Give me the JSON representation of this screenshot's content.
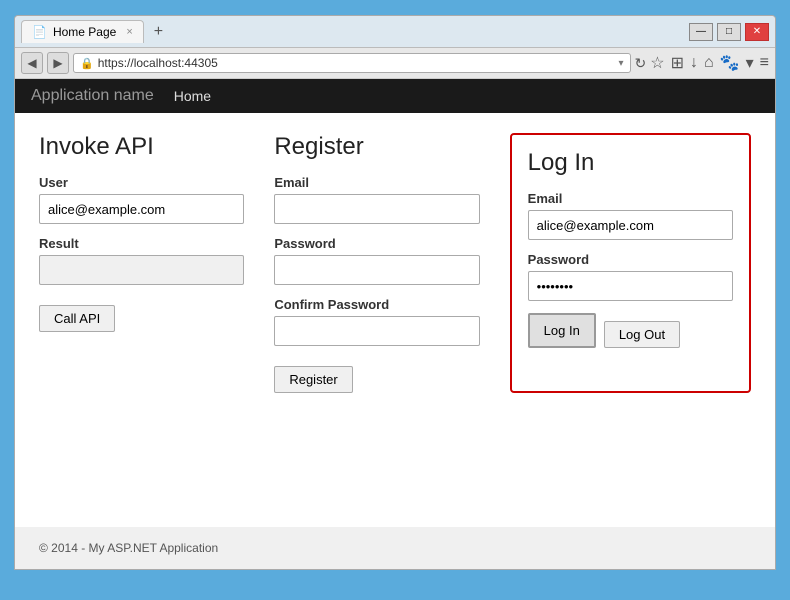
{
  "browser": {
    "tab_title": "Home Page",
    "new_tab_label": "+",
    "tab_close": "×",
    "url": "https://localhost:44305",
    "nav_back": "◀",
    "nav_forward": "▶",
    "lock_icon": "🔒",
    "refresh_icon": "↻",
    "dropdown_icon": "▾",
    "star_icon": "☆",
    "clipboard_icon": "⊞",
    "download_icon": "↓",
    "home_icon": "⌂",
    "menu_icon": "≡",
    "win_minimize": "—",
    "win_restore": "□",
    "win_close": "✕"
  },
  "navbar": {
    "app_name": "Application name",
    "nav_link": "Home"
  },
  "invoke_api": {
    "title": "Invoke API",
    "user_label": "User",
    "user_placeholder": "alice@example.com",
    "user_value": "alice@example.com",
    "result_label": "Result",
    "result_value": "",
    "call_api_btn": "Call API"
  },
  "register": {
    "title": "Register",
    "email_label": "Email",
    "email_value": "",
    "password_label": "Password",
    "password_value": "",
    "confirm_label": "Confirm Password",
    "confirm_value": "",
    "register_btn": "Register"
  },
  "login": {
    "title": "Log In",
    "email_label": "Email",
    "email_value": "alice@example.com",
    "password_label": "Password",
    "password_value": "••••••••",
    "login_btn": "Log In",
    "logout_btn": "Log Out"
  },
  "footer": {
    "text": "© 2014 - My ASP.NET Application"
  }
}
